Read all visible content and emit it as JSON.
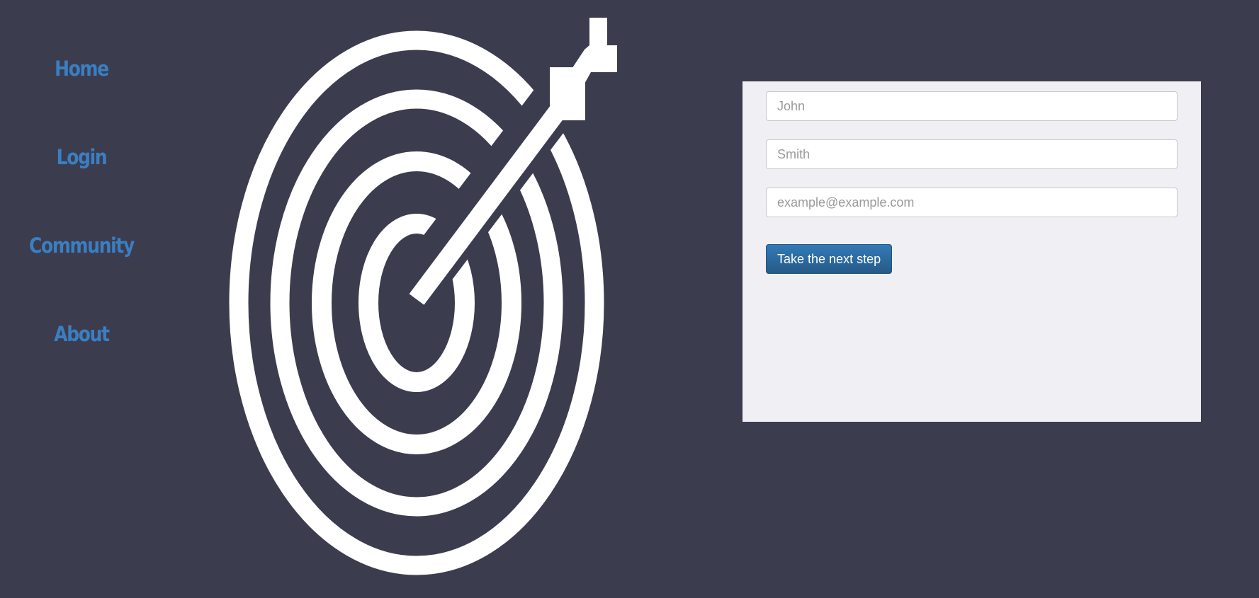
{
  "nav": {
    "items": [
      {
        "label": "Home"
      },
      {
        "label": "Login"
      },
      {
        "label": "Community"
      },
      {
        "label": "About"
      }
    ]
  },
  "logo": {
    "icon": "target-arrow-icon",
    "color": "#ffffff"
  },
  "form": {
    "first_name": {
      "placeholder": "John"
    },
    "last_name": {
      "placeholder": "Smith"
    },
    "email": {
      "placeholder": "example@example.com"
    },
    "submit_label": "Take the next step"
  },
  "colors": {
    "background": "#3c3c4f",
    "nav_link": "#3a7fc2",
    "panel": "#efeff4",
    "button": "#2e6da4"
  }
}
